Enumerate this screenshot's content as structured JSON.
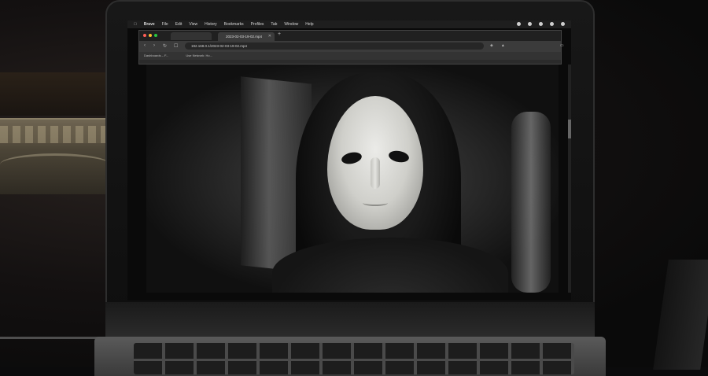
{
  "menubar": {
    "app_name": "Brave",
    "items": [
      "File",
      "Edit",
      "View",
      "History",
      "Bookmarks",
      "Profiles",
      "Tab",
      "Window",
      "Help"
    ]
  },
  "browser": {
    "active_tab_title": "2023-02-03-19-02.mp4",
    "url": "192.168.0.1/2023-02-03-19-02.mp4",
    "bookmarks": [
      "Dashboards – F...",
      "Use Network: Ho..."
    ]
  }
}
